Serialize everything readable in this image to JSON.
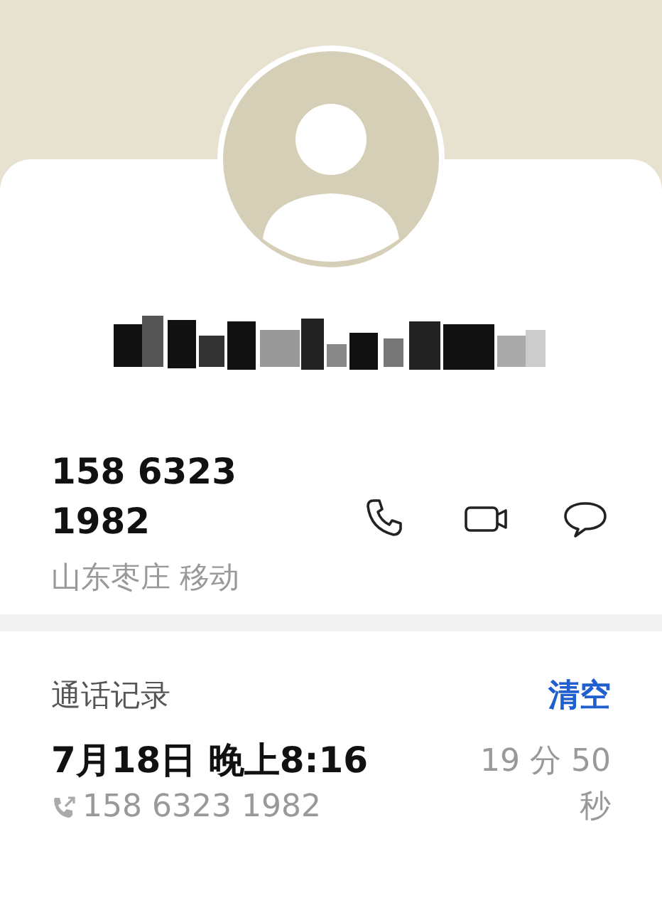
{
  "contact": {
    "number": "158 6323 1982",
    "location": "山东枣庄 移动"
  },
  "actions": [
    {
      "kind": "call"
    },
    {
      "kind": "video"
    },
    {
      "kind": "message"
    }
  ],
  "call_log": {
    "title": "通话记录",
    "clear": "清空",
    "entries": [
      {
        "kind": "outgoing",
        "time": "7月18日 晚上8:16",
        "number": "158 6323 1982",
        "duration": "19 分 50 秒"
      }
    ]
  }
}
